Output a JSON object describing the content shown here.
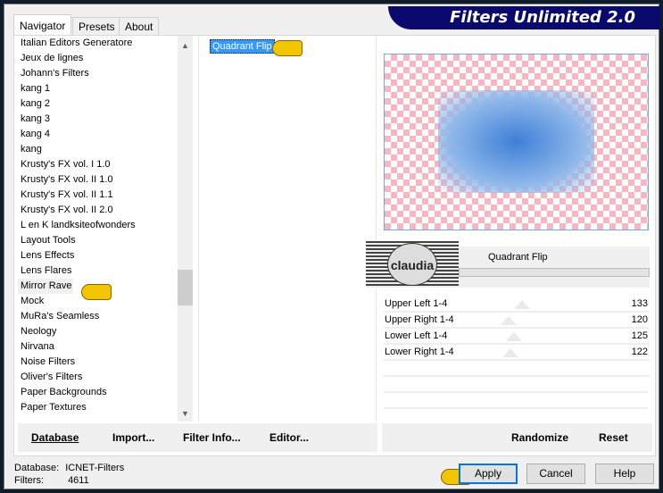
{
  "app": {
    "title": "Filters Unlimited 2.0"
  },
  "tabs": [
    {
      "label": "Navigator"
    },
    {
      "label": "Presets"
    },
    {
      "label": "About"
    }
  ],
  "categories": [
    "Italian Editors Generatore",
    "Jeux de lignes",
    "Johann's Filters",
    "kang 1",
    "kang 2",
    "kang 3",
    "kang 4",
    "kang",
    "Krusty's FX vol. I 1.0",
    "Krusty's FX vol. II 1.0",
    "Krusty's FX vol. II 1.1",
    "Krusty's FX vol. II 2.0",
    "L en K landksiteofwonders",
    "Layout Tools",
    "Lens Effects",
    "Lens Flares",
    "Mirror Rave",
    "Mock",
    "MuRa's Seamless",
    "Neology",
    "Nirvana",
    "Noise Filters",
    "Oliver's Filters",
    "Paper Backgrounds",
    "Paper Textures"
  ],
  "selected_category": "Mirror Rave",
  "filters": [
    "Quadrant Flip"
  ],
  "logo_text": "claudia",
  "filter_name": "Quadrant Flip",
  "params": [
    {
      "label": "Upper Left 1-4",
      "value": 133
    },
    {
      "label": "Upper Right 1-4",
      "value": 120
    },
    {
      "label": "Lower Left 1-4",
      "value": 125
    },
    {
      "label": "Lower Right 1-4",
      "value": 122
    }
  ],
  "param_range": [
    0,
    255
  ],
  "buttons": {
    "database": "Database",
    "import": "Import...",
    "filter_info": "Filter Info...",
    "editor": "Editor...",
    "randomize": "Randomize",
    "reset": "Reset",
    "apply": "Apply",
    "cancel": "Cancel",
    "help": "Help"
  },
  "status": {
    "database_label": "Database:",
    "database_value": "ICNET-Filters",
    "filters_label": "Filters:",
    "filters_value": "4611"
  },
  "colors": {
    "title_bg": "#0a0a6e",
    "selection": "#3399ff",
    "default_button_border": "#0078d7"
  }
}
